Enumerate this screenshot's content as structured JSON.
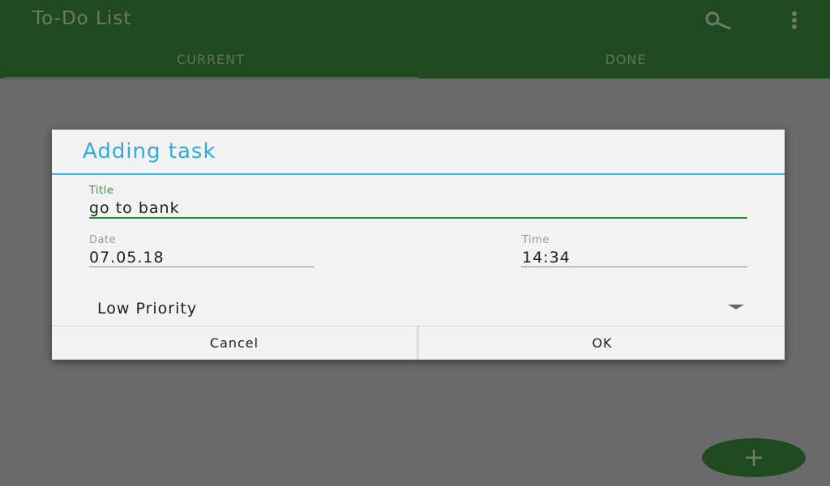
{
  "app": {
    "title": "To-Do List",
    "tabs": [
      {
        "label": "CURRENT",
        "selected": true
      },
      {
        "label": "DONE",
        "selected": false
      }
    ],
    "icons": {
      "search": "search-icon",
      "menu": "more-vert-icon",
      "fab": "add-icon"
    }
  },
  "dialog": {
    "title": "Adding task",
    "title_field": {
      "label": "Title",
      "value": "go to bank"
    },
    "date_field": {
      "label": "Date",
      "value": "07.05.18"
    },
    "time_field": {
      "label": "Time",
      "value": "14:34"
    },
    "priority": {
      "selected": "Low Priority"
    },
    "cancel_label": "Cancel",
    "ok_label": "OK"
  },
  "colors": {
    "primary": "#1f4a1f",
    "accent": "#33aadd",
    "field_active": "#2e8b2e",
    "scrim": "#6a6a6a"
  }
}
